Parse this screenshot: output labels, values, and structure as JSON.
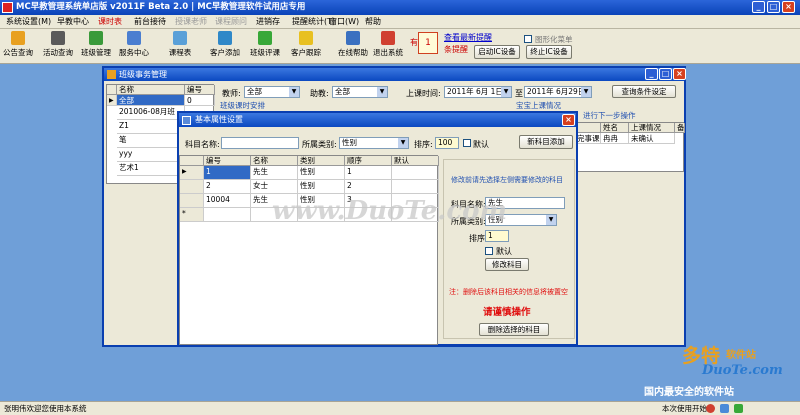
{
  "app": {
    "title": "MC早教管理系统单店版 v2011F Beta 2.0  | MC早教管理软件试用店专用"
  },
  "menu": [
    "系统设置(M)",
    "早教中心",
    "课时表",
    "前台接待",
    "授课老师",
    "课程顾问",
    "进销存",
    "提醒统计(T)",
    "窗口(W)",
    "帮助"
  ],
  "toolbar": {
    "items": [
      "公告查询",
      "活动查询",
      "班级管理",
      "服务中心",
      "课程表",
      "客户添加",
      "班级评课",
      "客户跟踪",
      "在线帮助",
      "退出系统"
    ],
    "alert_prefix": "有",
    "alert_count": "1",
    "alert_line1": "查看最新提醒",
    "alert_line2": "条提醒",
    "start_ic": "启动IC设备",
    "stop_ic": "终止IC设备",
    "hide_cb": "图形化菜单"
  },
  "win1": {
    "title": "班级事务管理",
    "list_headers": [
      "名称",
      "编号"
    ],
    "list_rows": [
      [
        "全部",
        "0"
      ],
      [
        "201006-08月班",
        ""
      ],
      [
        "Z1",
        ""
      ],
      [
        "笔",
        ""
      ],
      [
        "yyy",
        ""
      ],
      [
        "艺术1",
        ""
      ]
    ],
    "teacher_label": "教师:",
    "teacher_value": "全部",
    "assistant_label": "助教:",
    "assistant_value": "全部",
    "date_label": "上课时间:",
    "date_from": "2011年 6月 1日",
    "to_label": "至",
    "date_to": "2011年 6月29日",
    "query_btn": "查询条件设定",
    "left_caption": "班级课时安排",
    "right_caption": "宝宝上课情况",
    "next_caption": "进行下一步操作",
    "right_headers": [
      "",
      "姓名",
      "上课情况",
      "备"
    ],
    "right_row": [
      "完事课",
      "冉冉",
      "未确认",
      ""
    ]
  },
  "dialog": {
    "title": "基本属性设置",
    "subject_label": "科目名称:",
    "subject_value": "",
    "category_label": "所属类别:",
    "category_value": "性别",
    "order_label": "排序:",
    "order_value": "100",
    "default_label": "默认",
    "add_btn": "新科目添加",
    "headers": [
      "编号",
      "名称",
      "类别",
      "顺序",
      "默认"
    ],
    "rows": [
      [
        "1",
        "先生",
        "性别",
        "1",
        ""
      ],
      [
        "2",
        "女士",
        "性别",
        "2",
        ""
      ],
      [
        "10004",
        "先生",
        "性别",
        "3",
        ""
      ]
    ],
    "new_row_marker": "*",
    "edit_hint": "修改前请先选择左侧需要修改的科目",
    "edit_subject_label": "科目名称:",
    "edit_subject_value": "先生",
    "edit_category_label": "所属类别:",
    "edit_category_value": "性别",
    "edit_order_label": "排序:",
    "edit_order_value": "1",
    "edit_default_label": "默认",
    "modify_btn": "修改科目",
    "warn_text": "注：删除后该科目相关的信息将被置空",
    "caution_text": "请谨慎操作",
    "delete_btn": "删除选择的科目"
  },
  "status": {
    "left": "张明伟欢迎您使用本系统",
    "right": "本次使用开始"
  },
  "watermark": {
    "center": "www.DuoTe.com",
    "logo_cn": "多特",
    "logo_sub": "软件站",
    "logo_en": "DuoTe.com",
    "logo_tag": "国内最安全的软件站"
  },
  "colors": {
    "title": "#0a43b8",
    "desk": "#6f9fd8",
    "warn": "#e01010"
  }
}
